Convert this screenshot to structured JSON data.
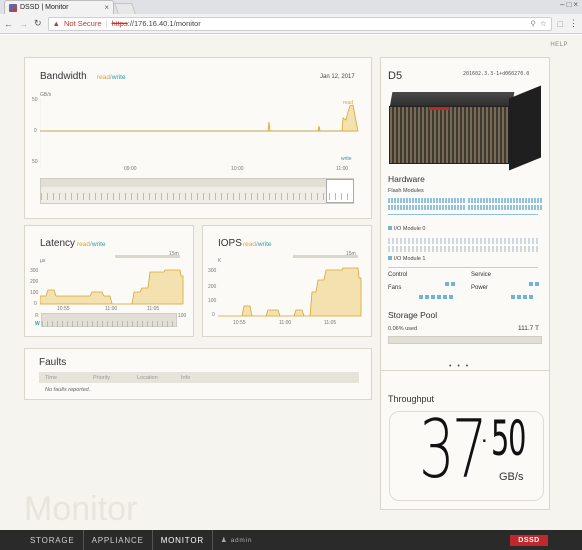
{
  "browser": {
    "tab_title": "DSSD | Monitor",
    "tab_close": "×",
    "url_warning": "Not Secure",
    "url_scheme": "https",
    "url_rest": "://176.16.40.1/monitor",
    "win_controls": [
      "–",
      "□",
      "×"
    ]
  },
  "app": {
    "help": "HELP",
    "watermark": "Monitor"
  },
  "bandwidth": {
    "title": "Bandwidth",
    "read": "read",
    "slash": "/",
    "write": "write",
    "date": "Jan 12, 2017",
    "unit": "GB/s",
    "y_top": "50",
    "y_mid": "0",
    "y_bot": "50",
    "read_tag": "read",
    "write_tag": "write",
    "x_ticks": [
      "09:00",
      "10:00",
      "11:00"
    ]
  },
  "latency": {
    "title": "Latency",
    "read": "read",
    "slash": "/",
    "write": "write",
    "range": "15m",
    "unit": "µs",
    "y_ticks": [
      "300",
      "200",
      "100",
      "0"
    ],
    "x_ticks": [
      "10:55",
      "11:00",
      "11:05"
    ],
    "r_mark": "R",
    "w_mark": "W",
    "right_mark": "100"
  },
  "iops": {
    "title": "IOPS",
    "read": "read",
    "slash": "/",
    "write": "write",
    "range": "15m",
    "unit": "K",
    "y_ticks": [
      "300",
      "200",
      "100",
      "0"
    ],
    "x_ticks": [
      "10:55",
      "11:00",
      "11:05"
    ]
  },
  "faults": {
    "title": "Faults",
    "columns": [
      "Time",
      "Priority",
      "Location",
      "Info"
    ],
    "empty": "No faults reported."
  },
  "device": {
    "name": "D5",
    "serial": "201602.3.3-1+d060270.0",
    "hardware": "Hardware",
    "flash_modules": "Flash Modules",
    "io0": "I/O Module 0",
    "io1": "I/O Module 1",
    "control": "Control",
    "service": "Service",
    "fans": "Fans",
    "power": "Power",
    "storage_pool": "Storage Pool",
    "used": "0.06% used",
    "capacity": "111.7 T"
  },
  "throughput": {
    "pager": "• • •",
    "title": "Throughput",
    "big": "37",
    "dot": ".",
    "frac": "50",
    "unit": "GB/s"
  },
  "navbar": {
    "items": [
      "STORAGE",
      "APPLIANCE",
      "MONITOR"
    ],
    "user": "admin",
    "brand": "DSSD"
  },
  "colors": {
    "read": "#d9a52d",
    "write": "#2aa199",
    "navbar": "#2a2a2a",
    "brand": "#c0282b"
  }
}
